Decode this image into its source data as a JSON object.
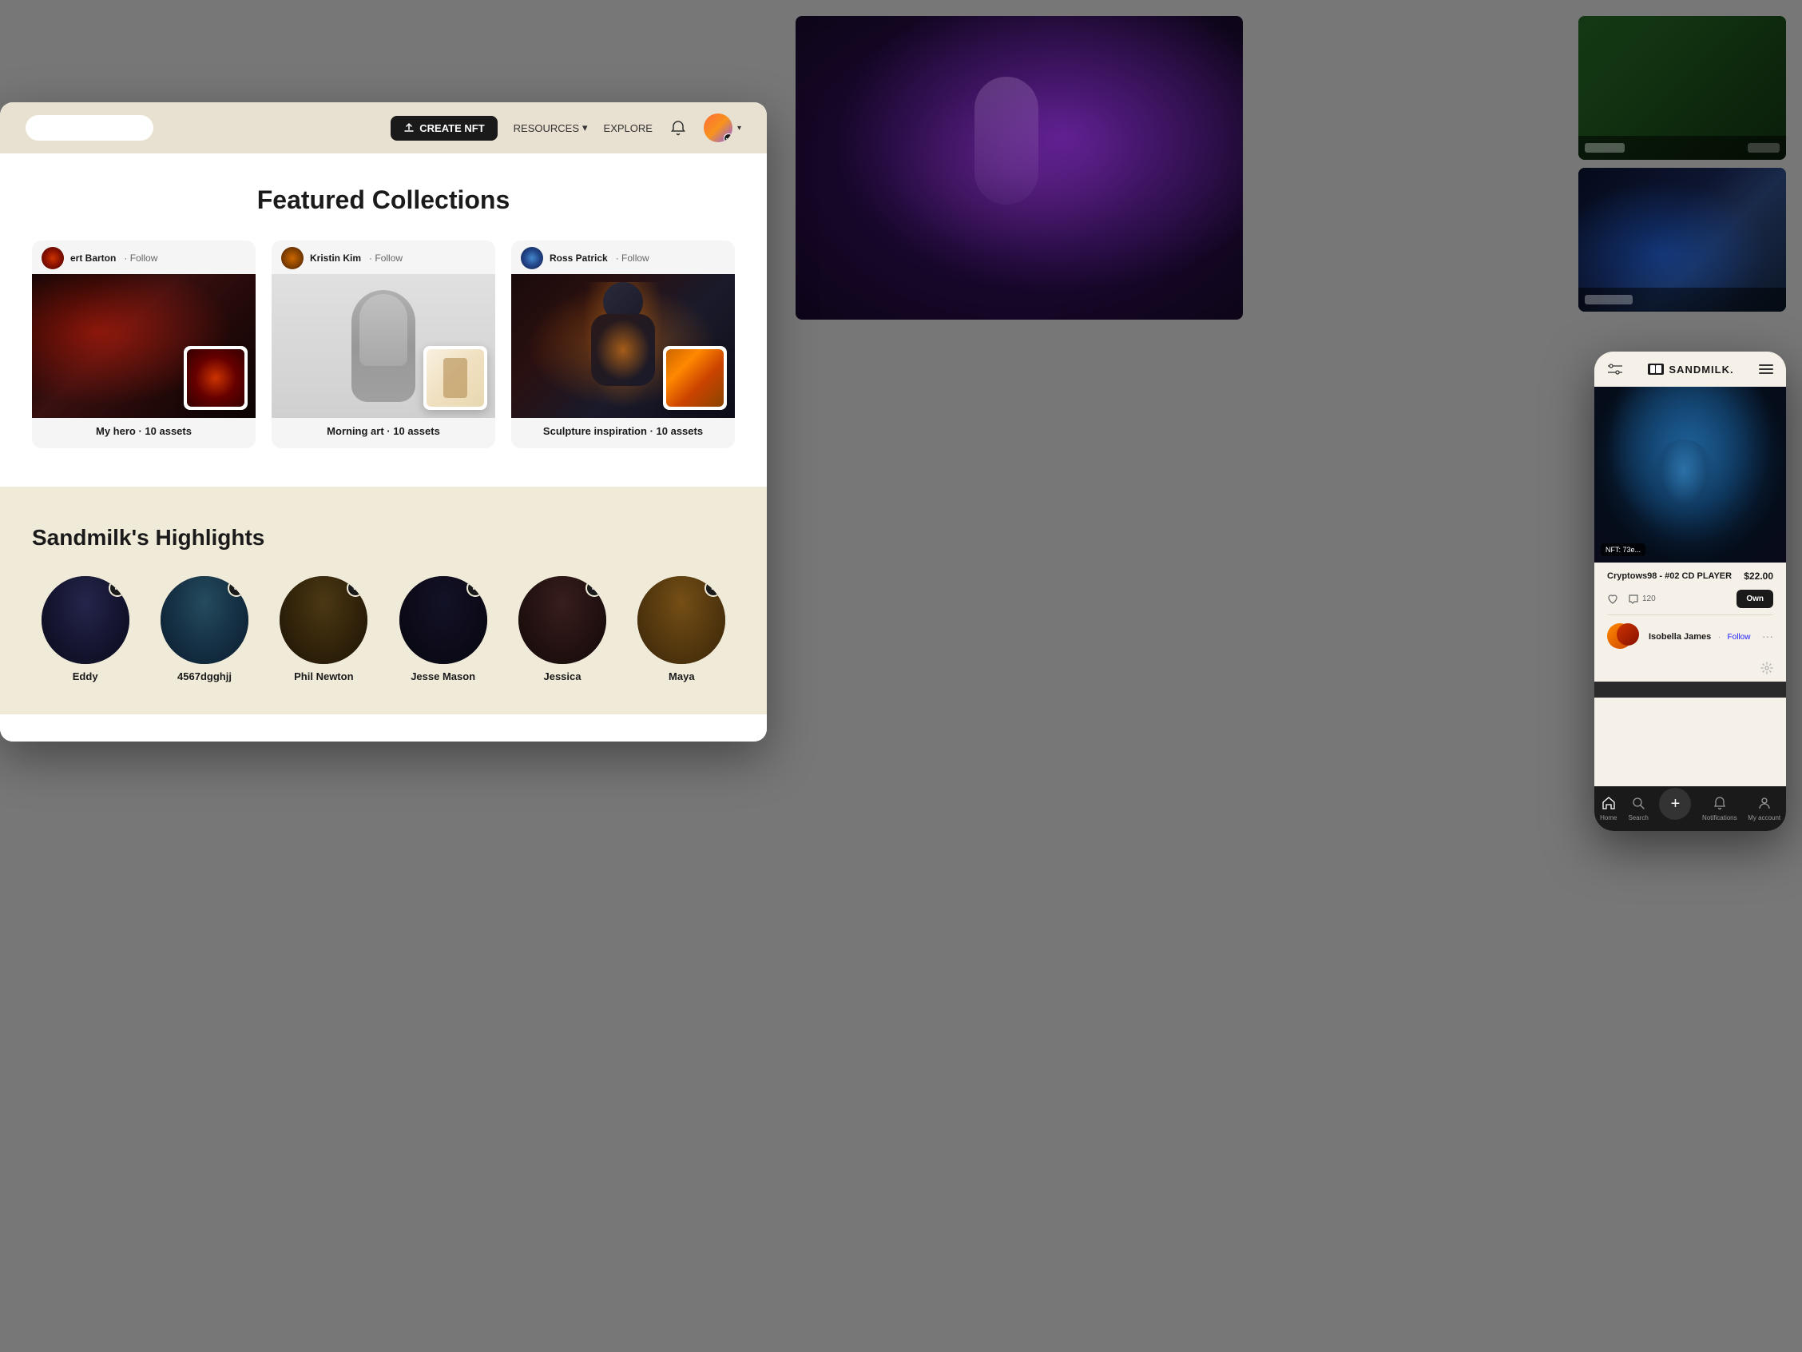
{
  "background": {
    "color": "#777777"
  },
  "header": {
    "create_nft_label": "CREATE NFT",
    "resources_label": "RESOURCES",
    "explore_label": "EXPLORE"
  },
  "featured": {
    "title": "Featured Collections",
    "collections": [
      {
        "creator_name": "ert Barton",
        "follow_label": "Follow",
        "collection_name": "My hero",
        "asset_count": "10 assets"
      },
      {
        "creator_name": "Kristin Kim",
        "follow_label": "Follow",
        "collection_name": "Morning art",
        "asset_count": "10 assets"
      },
      {
        "creator_name": "Ross Patrick",
        "follow_label": "Follow",
        "collection_name": "Sculpture inspiration",
        "asset_count": "10 assets"
      }
    ]
  },
  "highlights": {
    "title": "Sandmilk's Highlights",
    "artists": [
      {
        "name": "Eddy",
        "verified": true
      },
      {
        "name": "4567dgghjj",
        "verified": true
      },
      {
        "name": "Phil Newton",
        "verified": true
      },
      {
        "name": "Jesse Mason",
        "verified": true
      },
      {
        "name": "Jessica",
        "verified": true
      },
      {
        "name": "Maya",
        "verified": true
      }
    ]
  },
  "mobile": {
    "logo": "SANDMILK.",
    "nft_tag": "NFT: 73e...",
    "nft_title": "Cryptows98 - #02 CD PLAYER",
    "nft_price": "$22.00",
    "like_count": "120",
    "own_label": "Own",
    "creator_name": "Isobella James",
    "creator_follow": "Follow",
    "nav": {
      "home_label": "Home",
      "search_label": "Search",
      "notifications_label": "Notifications",
      "account_label": "My account"
    }
  }
}
